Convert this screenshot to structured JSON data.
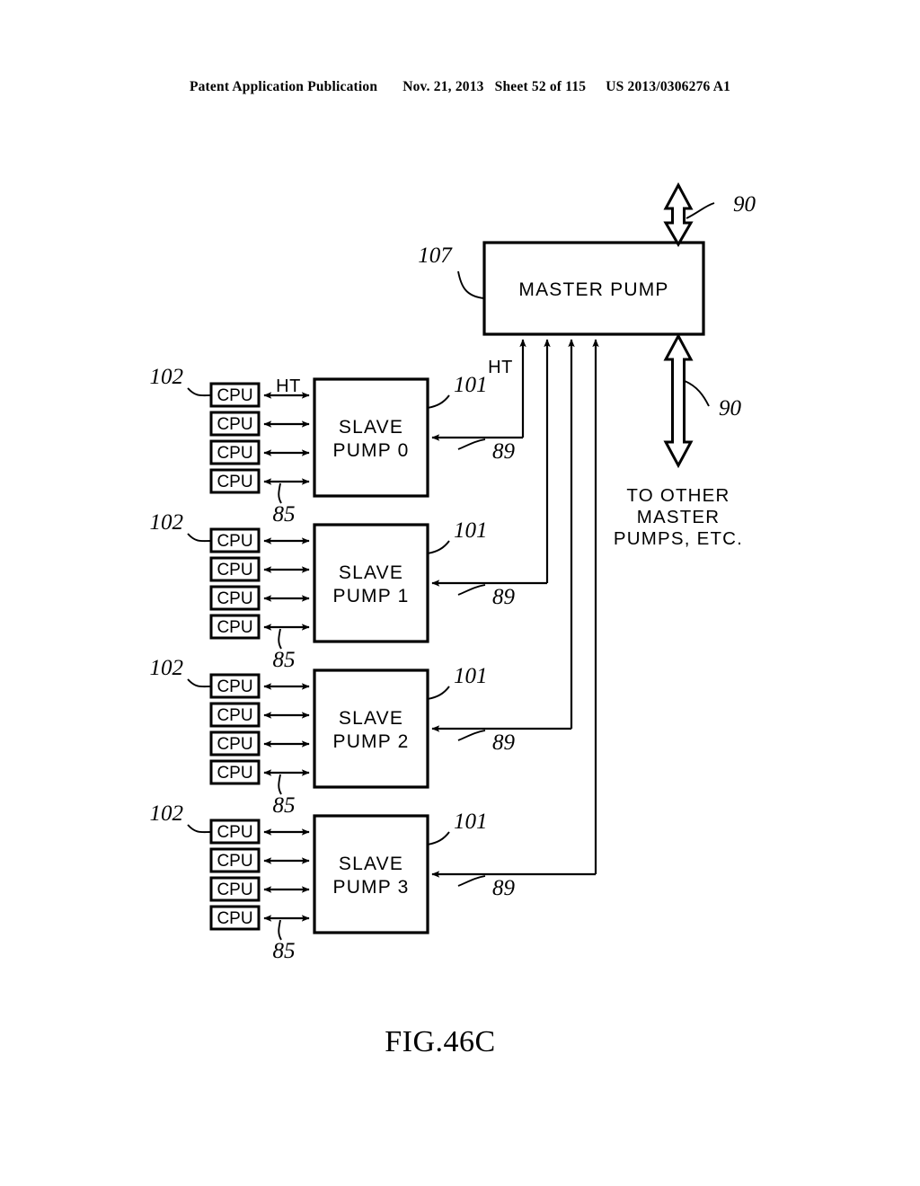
{
  "page": {
    "header": {
      "publication": "Patent Application Publication",
      "date": "Nov. 21, 2013",
      "sheet": "Sheet 52 of 115",
      "docnumber": "US 2013/0306276 A1"
    },
    "figure_caption": "FIG.46C"
  },
  "diagram": {
    "master_pump": {
      "label": "MASTER PUMP",
      "ref": "107"
    },
    "top_link": {
      "ref": "90"
    },
    "bottom_link": {
      "ref": "90",
      "caption_line1": "TO OTHER",
      "caption_line2": "MASTER",
      "caption_line3": "PUMPS, ETC."
    },
    "bus_label_master": "HT",
    "bus_label_slave": "HT",
    "cpu_label": "CPU",
    "refs": {
      "cpu_group": "102",
      "cpu_bus": "85",
      "slave_pump": "101",
      "feedback": "89"
    },
    "groups": [
      {
        "pump_line1": "SLAVE",
        "pump_line2": "PUMP  0",
        "cpus": [
          "CPU",
          "CPU",
          "CPU",
          "CPU"
        ]
      },
      {
        "pump_line1": "SLAVE",
        "pump_line2": "PUMP  1",
        "cpus": [
          "CPU",
          "CPU",
          "CPU",
          "CPU"
        ]
      },
      {
        "pump_line1": "SLAVE",
        "pump_line2": "PUMP  2",
        "cpus": [
          "CPU",
          "CPU",
          "CPU",
          "CPU"
        ]
      },
      {
        "pump_line1": "SLAVE",
        "pump_line2": "PUMP  3",
        "cpus": [
          "CPU",
          "CPU",
          "CPU",
          "CPU"
        ]
      }
    ]
  }
}
